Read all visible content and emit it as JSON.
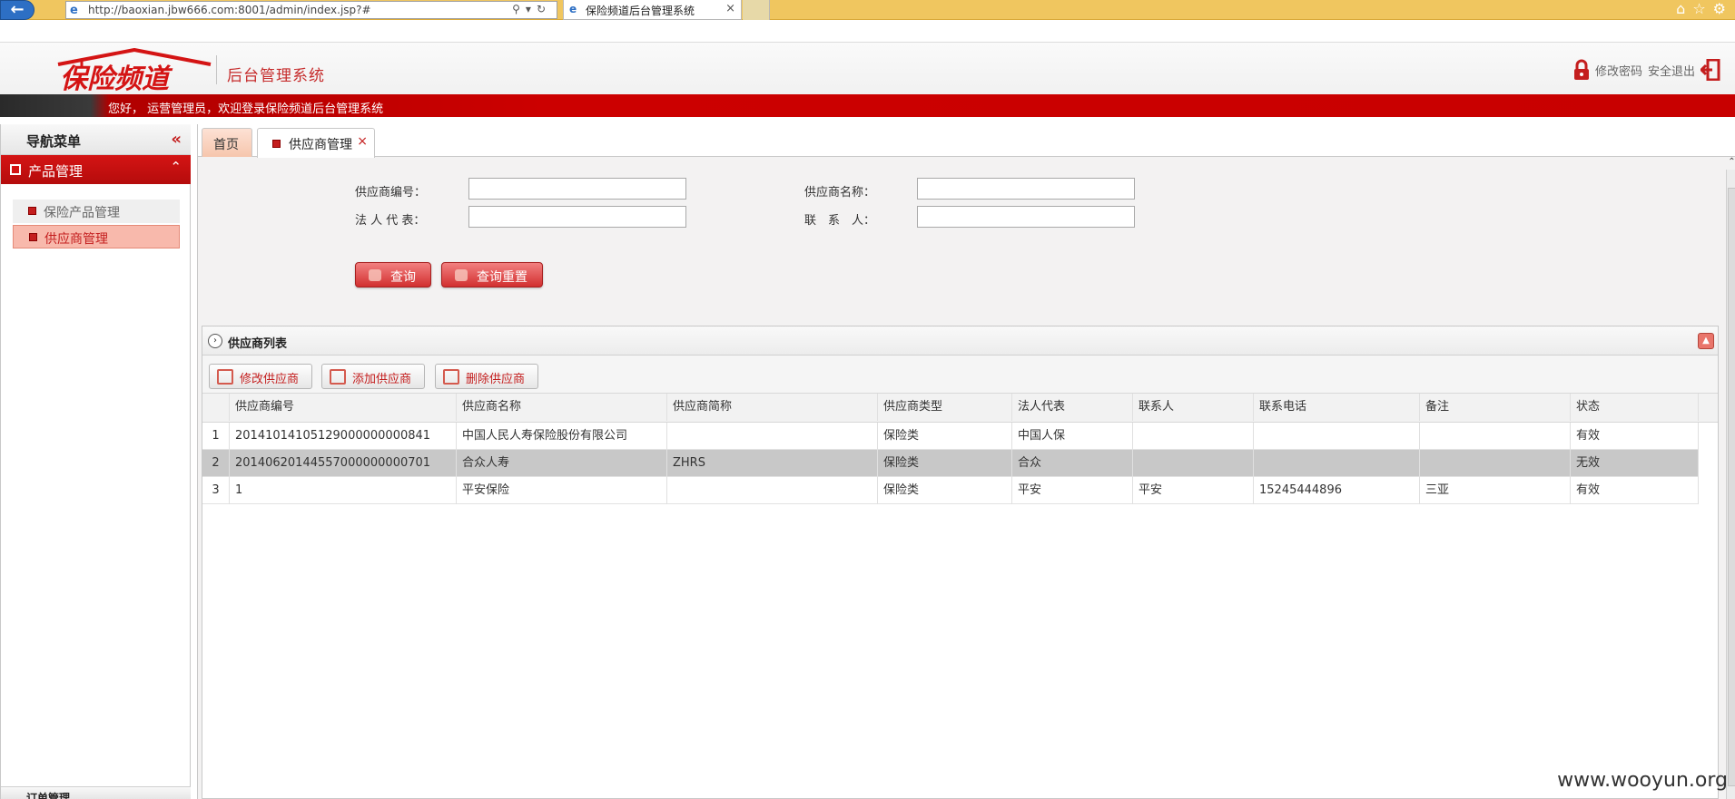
{
  "browser": {
    "url": "http://baoxian.jbw666.com:8001/admin/index.jsp?#",
    "tab_title": "保险频道后台管理系统",
    "icons": [
      "home-icon",
      "star-icon",
      "gear-icon"
    ]
  },
  "header": {
    "logo_text": "保险频道",
    "system_title": "后台管理系统",
    "change_password": "修改密码",
    "logout": "安全退出"
  },
  "welcome": {
    "text": "您好， 运营管理员，欢迎登录保险频道后台管理系统"
  },
  "nav": {
    "title": "导航菜单",
    "section": "产品管理",
    "items": [
      {
        "label": "保险产品管理",
        "active": false
      },
      {
        "label": "供应商管理",
        "active": true
      }
    ],
    "bottom_label": "订单管理"
  },
  "tabs": [
    {
      "label": "首页"
    },
    {
      "label": "供应商管理"
    }
  ],
  "form": {
    "supplier_code_label": "供应商编号：",
    "supplier_name_label": "供应商名称：",
    "legal_rep_label": "法 人 代 表：",
    "contact_label": "联　系　人：",
    "supplier_code_value": "",
    "supplier_name_value": "",
    "legal_rep_value": "",
    "contact_value": "",
    "search_button": "查询",
    "reset_button": "查询重置"
  },
  "panel": {
    "title": "供应商列表",
    "toolbar": {
      "edit": "修改供应商",
      "add": "添加供应商",
      "delete": "删除供应商"
    }
  },
  "table": {
    "columns": [
      "供应商编号",
      "供应商名称",
      "供应商简称",
      "供应商类型",
      "法人代表",
      "联系人",
      "联系电话",
      "备注",
      "状态"
    ],
    "rows": [
      {
        "num": "1",
        "cells": [
          "20141014105129000000000841",
          "中国人民人寿保险股份有限公司",
          "",
          "保险类",
          "中国人保",
          "",
          "",
          "",
          "有效"
        ],
        "selected": false
      },
      {
        "num": "2",
        "cells": [
          "20140620144557000000000701",
          "合众人寿",
          "ZHRS",
          "保险类",
          "合众",
          "",
          "",
          "",
          "无效"
        ],
        "selected": true
      },
      {
        "num": "3",
        "cells": [
          "1",
          "平安保险",
          "",
          "保险类",
          "平安",
          "平安",
          "15245444896",
          "三亚",
          "有效"
        ],
        "selected": false
      }
    ]
  },
  "watermark": "www.wooyun.org",
  "colors": {
    "brand_red": "#cc0000",
    "selected_row": "#c8c8c8",
    "active_nav": "#f8b9ac"
  }
}
